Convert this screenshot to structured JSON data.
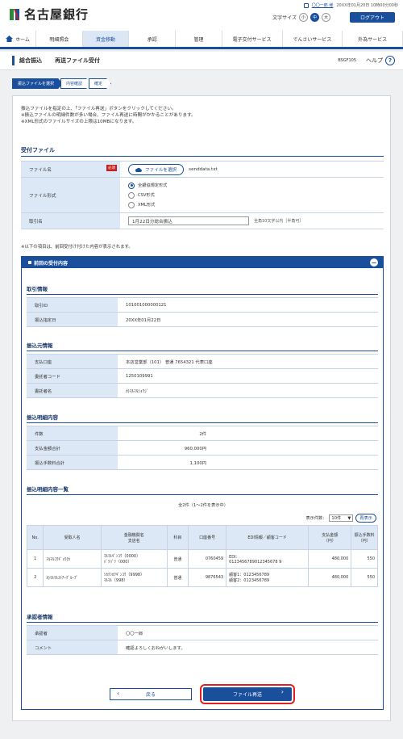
{
  "header": {
    "bank_name": "名古屋銀行",
    "user_name": "〇〇一郎 様",
    "last_login": "20XX年01月20日 10時00分00秒",
    "font_size_label": "文字サイズ",
    "font_sizes": [
      "小",
      "中",
      "大"
    ],
    "logout_label": "ログアウト"
  },
  "nav": {
    "items": [
      "ホーム",
      "明細照会",
      "資金移動",
      "承認",
      "管理",
      "電子交付サービス",
      "でんさいサービス",
      "外為サービス"
    ],
    "active": "資金移動"
  },
  "title": {
    "section": "総合振込",
    "page": "再送ファイル受付",
    "screen_id": "BSGF105",
    "help_label": "ヘルプ",
    "help_icon": "?"
  },
  "steps": [
    "振込ファイルを選択",
    "内容確認",
    "確定"
  ],
  "intro": [
    "振込ファイルを指定の上、「ファイル再送」ボタンをクリックしてください。",
    "※振込ファイルの明細件数が多い場合、ファイル再送に時間がかかることがあります。",
    "※XML形式のファイルサイズの上限は10MBになります。"
  ],
  "upload": {
    "heading": "受付ファイル",
    "file_label": "ファイル名",
    "required": "必須",
    "select_button": "ファイルを選択",
    "file_value": "senddata.txt",
    "format_label": "ファイル形式",
    "formats": [
      "全銀協規定形式",
      "CSV形式",
      "XML形式"
    ],
    "format_selected": 0,
    "name_label": "取引名",
    "name_value": "1月22日分総合振込",
    "name_hint": "全角10文字以内［半角可］"
  },
  "note_prev": "※以下の項目は、前回受付け付けた内容が表示されます。",
  "panel": {
    "title": "前回の受付内容",
    "collapse_icon": "−",
    "trade": {
      "heading": "取引情報",
      "rows": [
        {
          "label": "取引ID",
          "value": "101001000000121"
        },
        {
          "label": "振込指定日",
          "value": "20XX年01月22日"
        }
      ]
    },
    "source": {
      "heading": "振込元情報",
      "rows": [
        {
          "label": "支払口座",
          "value": "本店営業部（101） 普通 7654321 代表口座"
        },
        {
          "label": "委託者コード",
          "value": "1250109991"
        },
        {
          "label": "委託者名",
          "value": "ｶ)ﾏﾙﾏﾙｼｮｳｼﾞ"
        }
      ]
    },
    "detail": {
      "heading": "振込明細内容",
      "rows": [
        {
          "label": "件数",
          "value": "2件"
        },
        {
          "label": "支払金額合計",
          "value": "960,000円"
        },
        {
          "label": "振込手数料合計",
          "value": "1,100円"
        }
      ]
    },
    "list": {
      "heading": "振込明細内容一覧",
      "count_text": "全2件（1～2件を表示中）",
      "page_size_label": "表示件数：",
      "page_size_value": "10件",
      "redisplay": "再表示",
      "columns": [
        "No.",
        "受取人名",
        "金融機関名\n支店名",
        "科目",
        "口座番号",
        "EDI情報／顧客コード",
        "支払金額\n（円）",
        "振込手数料\n（円）"
      ],
      "rows": [
        {
          "no": "1",
          "name": "ﾏﾙﾏﾙｺｳｷﾞｮｳ(ｶ",
          "bank": "ﾏﾙﾏﾙｷﾞﾝｺｳ（0000）",
          "branch": "ﾊﾞﾂﾊﾞﾂ（000）",
          "type": "普通",
          "acct": "0760459",
          "edi1": "EDI：",
          "edi2": "0123456789012345678 9",
          "amount": "480,000",
          "fee": "550"
        },
        {
          "no": "2",
          "name": "ｶ)ﾏﾙﾏﾙｽﾄｱｰｸﾞﾙｰﾌﾟ",
          "bank": "ｼｶｸｼｶｸｷﾞﾝｺｳ（9998）",
          "branch": "ﾏﾙﾏﾙ（998）",
          "type": "普通",
          "acct": "9876543",
          "edi1": "顧客1：0123456789",
          "edi2": "顧客2：0123456789",
          "amount": "480,000",
          "fee": "550"
        }
      ]
    },
    "approver": {
      "heading": "承認者情報",
      "rows": [
        {
          "label": "承認者",
          "value": "〇〇一郎"
        },
        {
          "label": "コメント",
          "value": "確認よろしくおねがいします。"
        }
      ]
    }
  },
  "buttons": {
    "back": "戻る",
    "resend": "ファイル再送"
  },
  "colors": {
    "primary": "#1a4f9c",
    "label_bg": "#dce8f5",
    "highlight": "#e02020",
    "required": "#c42020"
  }
}
